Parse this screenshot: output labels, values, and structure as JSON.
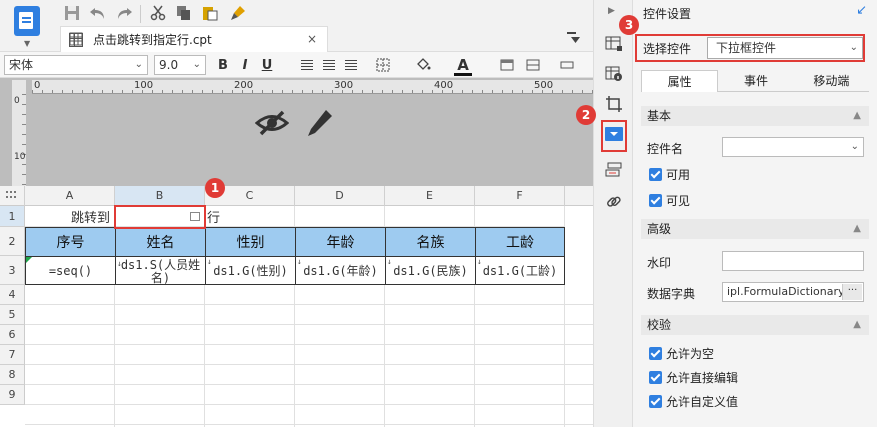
{
  "editor": {
    "tab_title": "点击跳转到指定行.cpt",
    "tab_close": "×",
    "font_name": "宋体",
    "font_size": "9.0"
  },
  "ruler": {
    "h_ticks": [
      "0",
      "100",
      "200",
      "300",
      "400",
      "500"
    ],
    "v_ticks": [
      "0",
      "10"
    ]
  },
  "sheet": {
    "columns": [
      "A",
      "B",
      "C",
      "D",
      "E",
      "F"
    ],
    "rows": [
      "1",
      "2",
      "3",
      "4",
      "5",
      "6",
      "7",
      "8",
      "9"
    ],
    "row1_label": "跳转到",
    "row1_suffix": "行",
    "headers": [
      "序号",
      "姓名",
      "性别",
      "年龄",
      "名族",
      "工龄"
    ],
    "data_row": [
      "=seq()",
      "ds1.S(人员姓名)",
      "ds1.G(性别)",
      "ds1.G(年龄)",
      "ds1.G(民族)",
      "ds1.G(工龄)"
    ]
  },
  "callouts": [
    "1",
    "2",
    "3"
  ],
  "panel": {
    "title": "控件设置",
    "select_label": "选择控件",
    "select_value": "下拉框控件",
    "tabs": [
      "属性",
      "事件",
      "移动端"
    ],
    "active_tab": "属性",
    "sections": {
      "basic": "基本",
      "advanced": "高级",
      "validate": "校验"
    },
    "fields": {
      "control_name": "控件名",
      "enabled": "可用",
      "visible": "可见",
      "watermark": "水印",
      "dict": "数据字典",
      "dict_value": "ipl.FormulaDictionary",
      "dict_more": "···",
      "allow_empty": "允许为空",
      "allow_direct_edit": "允许直接编辑",
      "allow_custom": "允许自定义值"
    }
  },
  "colors": {
    "accent": "#2f7fe0",
    "callout": "#e03b36",
    "header_fill": "#9ecbf0"
  }
}
